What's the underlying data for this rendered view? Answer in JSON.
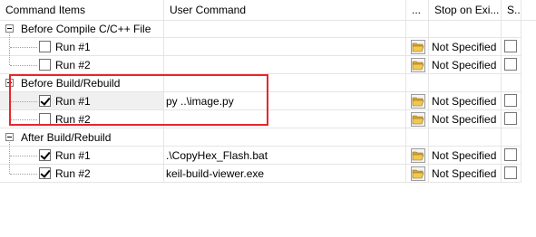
{
  "columns": {
    "command_items": "Command Items",
    "user_command": "User Command",
    "browse": "...",
    "stop_on_exit": "Stop on Exi...",
    "s": "S..."
  },
  "groups": [
    {
      "label": "Before Compile C/C++ File",
      "rows": [
        {
          "label": "Run #1",
          "checked": false,
          "command": "",
          "stop": "Not Specified"
        },
        {
          "label": "Run #2",
          "checked": false,
          "command": "",
          "stop": "Not Specified"
        }
      ]
    },
    {
      "label": "Before Build/Rebuild",
      "rows": [
        {
          "label": "Run #1",
          "checked": true,
          "command": "py ..\\image.py",
          "stop": "Not Specified"
        },
        {
          "label": "Run #2",
          "checked": false,
          "command": "",
          "stop": "Not Specified"
        }
      ]
    },
    {
      "label": "After Build/Rebuild",
      "rows": [
        {
          "label": "Run #1",
          "checked": true,
          "command": ".\\CopyHex_Flash.bat",
          "stop": "Not Specified"
        },
        {
          "label": "Run #2",
          "checked": true,
          "command": "keil-build-viewer.exe",
          "stop": "Not Specified"
        }
      ]
    }
  ],
  "colors": {
    "highlight": "#e8262b",
    "folder": "#f2c94c"
  },
  "icons": {
    "expander": "collapse-minus-icon",
    "browse": "folder-open-icon"
  }
}
